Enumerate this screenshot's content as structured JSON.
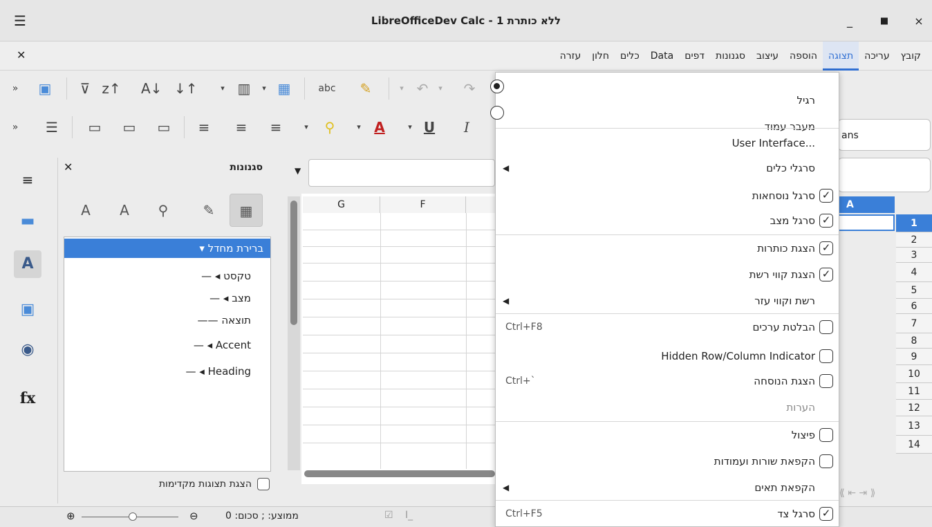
{
  "window": {
    "title": "LibreOfficeDev Calc - ללא כותרת 1",
    "min_glyph": "_",
    "max_glyph": "□",
    "close_glyph": "×"
  },
  "menubar": {
    "items": [
      "קובץ",
      "עריכה",
      "תצוגה",
      "הוספה",
      "עיצוב",
      "סגנונות",
      "דפים",
      "Data",
      "כלים",
      "חלון",
      "עזרה"
    ],
    "active": "תצוגה"
  },
  "toolbar2": {
    "font_name_partial": "ans"
  },
  "styles_panel": {
    "title": "סגנונות",
    "tree": {
      "root": "ברירת מחדל",
      "children": [
        "טקסט",
        "מצב",
        "תוצאה",
        "Accent",
        "Heading"
      ]
    },
    "show_previews_label": "הצגת תצוגות מקדימות"
  },
  "sheet": {
    "columns": [
      "G",
      "F"
    ],
    "right_column": "A",
    "rows": [
      "1",
      "2",
      "3",
      "4",
      "5",
      "6",
      "7",
      "8",
      "9",
      "10",
      "11",
      "12",
      "13",
      "14"
    ]
  },
  "statusbar": {
    "summary": "ממוצע: ; סכום: 0"
  },
  "view_menu": {
    "items": [
      {
        "label": "רגיל",
        "mark": "radio-on"
      },
      {
        "label": "מעבר עמוד",
        "mark": "radio-off"
      },
      {
        "label": "User Interface...",
        "mark": "none"
      },
      {
        "label": "סרגלי כלים",
        "mark": "submenu"
      },
      {
        "label": "סרגל נוסחאות",
        "mark": "check-on"
      },
      {
        "label": "סרגל מצב",
        "mark": "check-on"
      },
      {
        "label": "הצגת כותרות",
        "mark": "check-on"
      },
      {
        "label": "הצגת קווי רשת",
        "mark": "check-on"
      },
      {
        "label": "רשת וקווי עזר",
        "mark": "submenu"
      },
      {
        "label": "הבלטת ערכים",
        "mark": "check-off",
        "shortcut": "Ctrl+F8"
      },
      {
        "label": "Hidden Row/Column Indicator",
        "mark": "check-off"
      },
      {
        "label": "הצגת הנוסחה",
        "mark": "check-off",
        "shortcut": "Ctrl+`"
      },
      {
        "label": "הערות",
        "mark": "disabled"
      },
      {
        "label": "פיצול",
        "mark": "check-off"
      },
      {
        "label": "הקפאת שורות ועמודות",
        "mark": "check-off"
      },
      {
        "label": "הקפאת תאים",
        "mark": "submenu"
      },
      {
        "label": "סרגל צד",
        "mark": "check-on",
        "shortcut": "Ctrl+F5"
      }
    ]
  },
  "colors": {
    "accent": "#2f6fd3",
    "selection": "#3a7fd8"
  }
}
